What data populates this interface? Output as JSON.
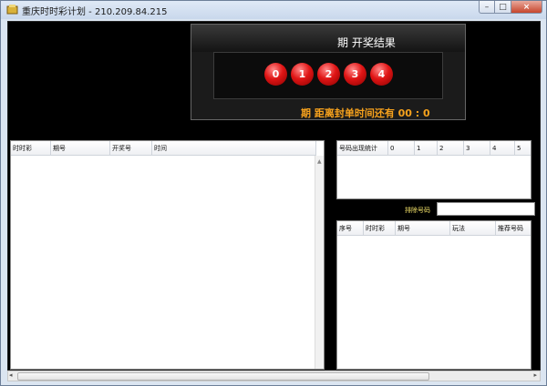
{
  "window": {
    "title": "重庆时时彩计划 - 210.209.84.215"
  },
  "result_board": {
    "title": "期 开奖结果",
    "balls": [
      "0",
      "1",
      "2",
      "3",
      "4"
    ],
    "countdown": "期 距离封单时间还有 00 : 0"
  },
  "history_table": {
    "columns": [
      "时时彩",
      "期号",
      "开奖号",
      "时间"
    ]
  },
  "stats_table": {
    "columns": [
      "号码出现统计",
      "0",
      "1",
      "2",
      "3",
      "4",
      "5"
    ]
  },
  "exclude": {
    "label": "排除号码",
    "value": ""
  },
  "recommend_table": {
    "columns": [
      "序号",
      "时时彩",
      "期号",
      "玩法",
      "推荐号码"
    ]
  },
  "colors": {
    "accent": "#f7a21d",
    "ball": "#e01515",
    "label_yellow": "#f5e36a"
  }
}
